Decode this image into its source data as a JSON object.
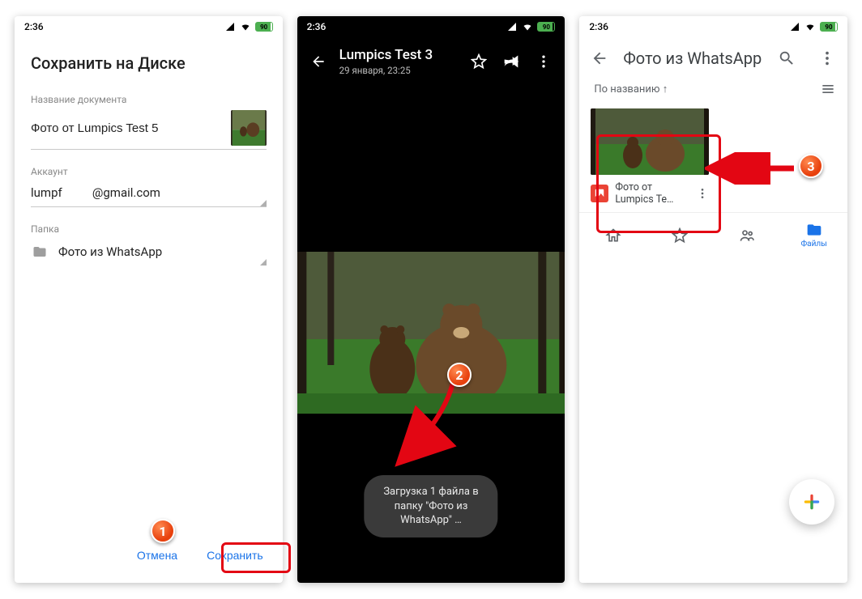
{
  "status": {
    "time": "2:36",
    "battery": "90"
  },
  "screen1": {
    "title": "Сохранить на Диске",
    "doc_label": "Название документа",
    "doc_value": "Фото от Lumpics Test 5",
    "account_label": "Аккаунт",
    "account_value": "lumpf          @gmail.com",
    "folder_label": "Папка",
    "folder_value": "Фото из WhatsApp",
    "cancel": "Отмена",
    "save": "Сохранить"
  },
  "screen2": {
    "title": "Lumpics Test 3",
    "subtitle": "29 января, 23:25",
    "toast": "Загрузка 1 файла в папку \"Фото из WhatsApp\" …"
  },
  "screen3": {
    "title": "Фото из WhatsApp",
    "sort": "По названию ↑",
    "file_name": "Фото от Lumpics Te…",
    "tab_files": "Файлы"
  },
  "badges": {
    "b1": "1",
    "b2": "2",
    "b3": "3"
  }
}
